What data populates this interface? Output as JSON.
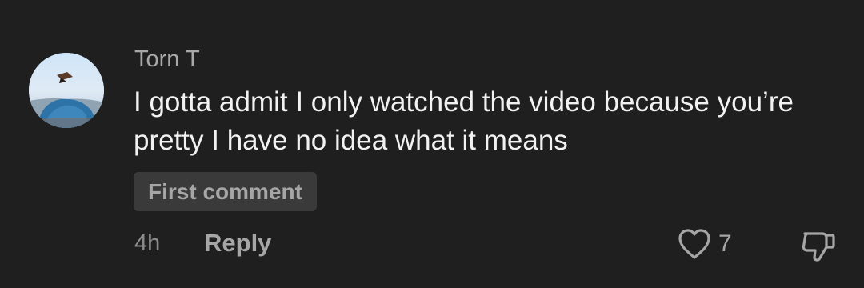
{
  "comment": {
    "username": "Torn T",
    "text": "I gotta admit I only watched the video because you’re pretty I have no idea what it means",
    "badge": "First comment",
    "time": "4h",
    "reply_label": "Reply",
    "like_count": "7",
    "avatar_icon": "user-avatar",
    "like_icon": "heart-outline-icon",
    "dislike_icon": "thumbs-down-icon"
  },
  "colors": {
    "background": "#1f1f1f",
    "text": "#f2f2f2",
    "secondary": "#a6a6a6",
    "badge_bg": "#3a3a3a"
  }
}
